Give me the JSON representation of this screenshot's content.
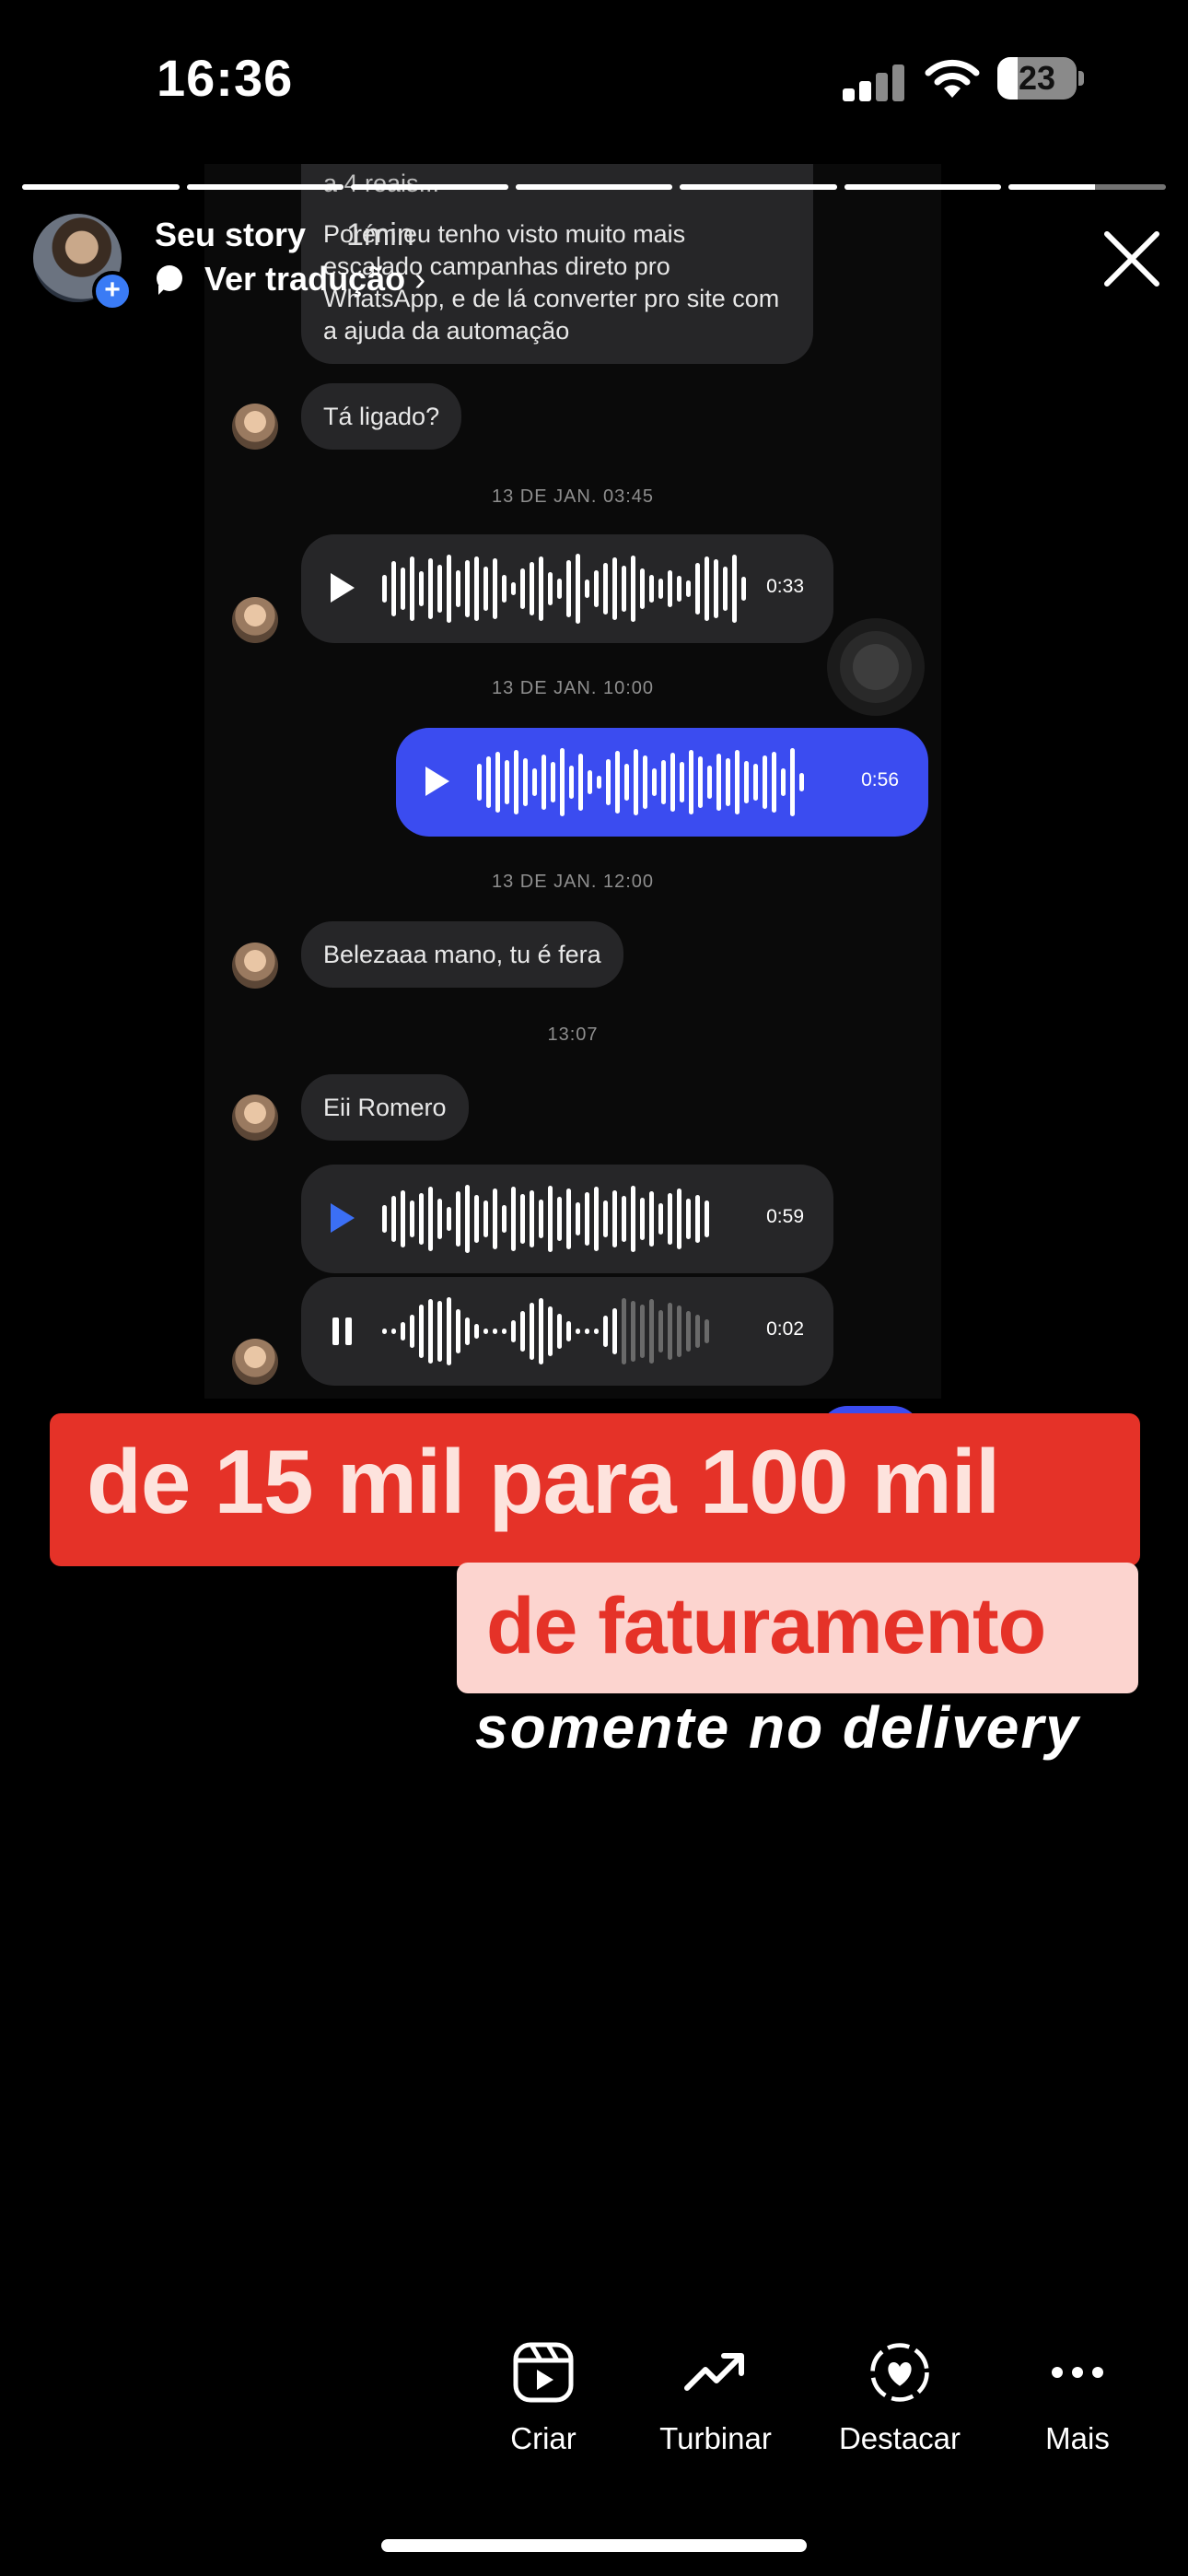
{
  "status_bar": {
    "time": "16:36",
    "battery": "23"
  },
  "story": {
    "progress_segments": [
      1,
      1,
      1,
      1,
      1,
      1,
      0.55
    ],
    "user": "Seu story",
    "time_ago": "1min",
    "translate_label": "Ver tradução"
  },
  "chat": {
    "msg_top_fragment": "a 4 reais...",
    "msg_long": [
      "Porém eu tenho visto muito mais",
      "escalado campanhas direto pro",
      "WhatsApp, e de lá converter pro site com",
      "a ajuda da automação"
    ],
    "msg_ligado": "Tá ligado?",
    "date1": "13 DE JAN. 03:45",
    "voice1_dur": "0:33",
    "date2": "13 DE JAN. 10:00",
    "voice2_dur": "0:56",
    "date3": "13 DE JAN. 12:00",
    "msg_beleza": "Belezaaa mano, tu é fera",
    "time4": "13:07",
    "msg_romero": "Eii Romero",
    "voice3_dur": "0:59",
    "voice4_dur": "0:02",
    "voice4_progress": 0.72
  },
  "overlay_text": {
    "line1": "de 15 mil para 100 mil",
    "line2": "de faturamento",
    "line3": "somente no delivery"
  },
  "actions": [
    {
      "label": "Criar",
      "icon": "reels-icon"
    },
    {
      "label": "Turbinar",
      "icon": "trending-up-icon"
    },
    {
      "label": "Destacar",
      "icon": "highlight-heart-icon"
    },
    {
      "label": "Mais",
      "icon": "more-dots-icon"
    }
  ],
  "colors": {
    "accent_blue": "#3b4cf0",
    "banner_red": "#e53228",
    "banner_pink": "#fcd4cf"
  }
}
